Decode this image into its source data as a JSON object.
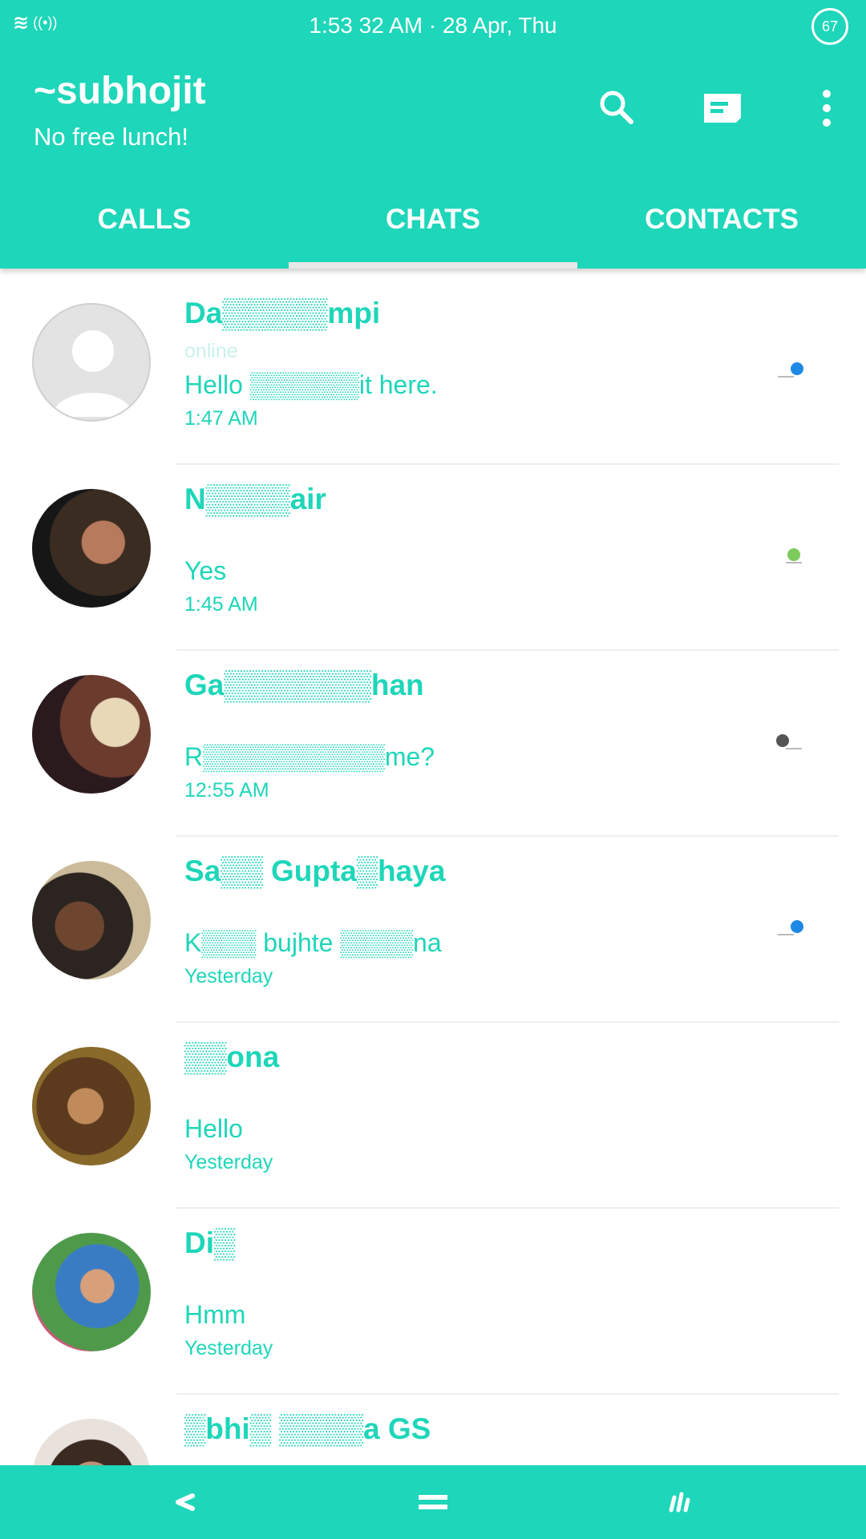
{
  "status_bar": {
    "time": "1:53 32 AM · 28 Apr, Thu",
    "battery": "67",
    "signal_icon": "signal-icon",
    "wifi_icon": "hotspot-icon"
  },
  "header": {
    "title": "~subhojit",
    "subtitle": "No free lunch!",
    "actions": [
      "search-icon",
      "compose-icon",
      "more-vert-icon"
    ]
  },
  "tabs": [
    {
      "label": "CALLS",
      "active": false
    },
    {
      "label": "CHATS",
      "active": true
    },
    {
      "label": "CONTACTS",
      "active": false
    }
  ],
  "chats": [
    {
      "name": "Da▒▒▒▒▒mpi",
      "status": "online",
      "message": "Hello ▒▒▒▒▒▒it here.",
      "time": "1:47 AM",
      "indicator_color": "#1E88E5"
    },
    {
      "name": "N▒▒▒▒air",
      "message": "Yes",
      "time": "1:45 AM",
      "indicator_color": "#7CCB5B"
    },
    {
      "name": "Ga▒▒▒▒▒▒▒han",
      "message": "R▒▒▒▒▒▒▒▒▒▒me?",
      "time": "12:55 AM",
      "indicator_color": "#555555"
    },
    {
      "name": "Sa▒▒ Gupta▒haya",
      "message": "K▒▒▒ bujhte ▒▒▒▒na",
      "time": "Yesterday",
      "indicator_color": "#1E88E5"
    },
    {
      "name": "▒▒ona",
      "message": "Hello",
      "time": "Yesterday"
    },
    {
      "name": "Di▒",
      "message": "Hmm",
      "time": "Yesterday"
    },
    {
      "name": "▒bhi▒ ▒▒▒▒a GS",
      "message": "",
      "time": ""
    }
  ],
  "colors": {
    "accent": "#1ED6B9",
    "text_on_accent": "#ffffff",
    "divider": "#eeeeee"
  },
  "navbar": [
    "back-icon",
    "home-icon",
    "recents-icon"
  ]
}
